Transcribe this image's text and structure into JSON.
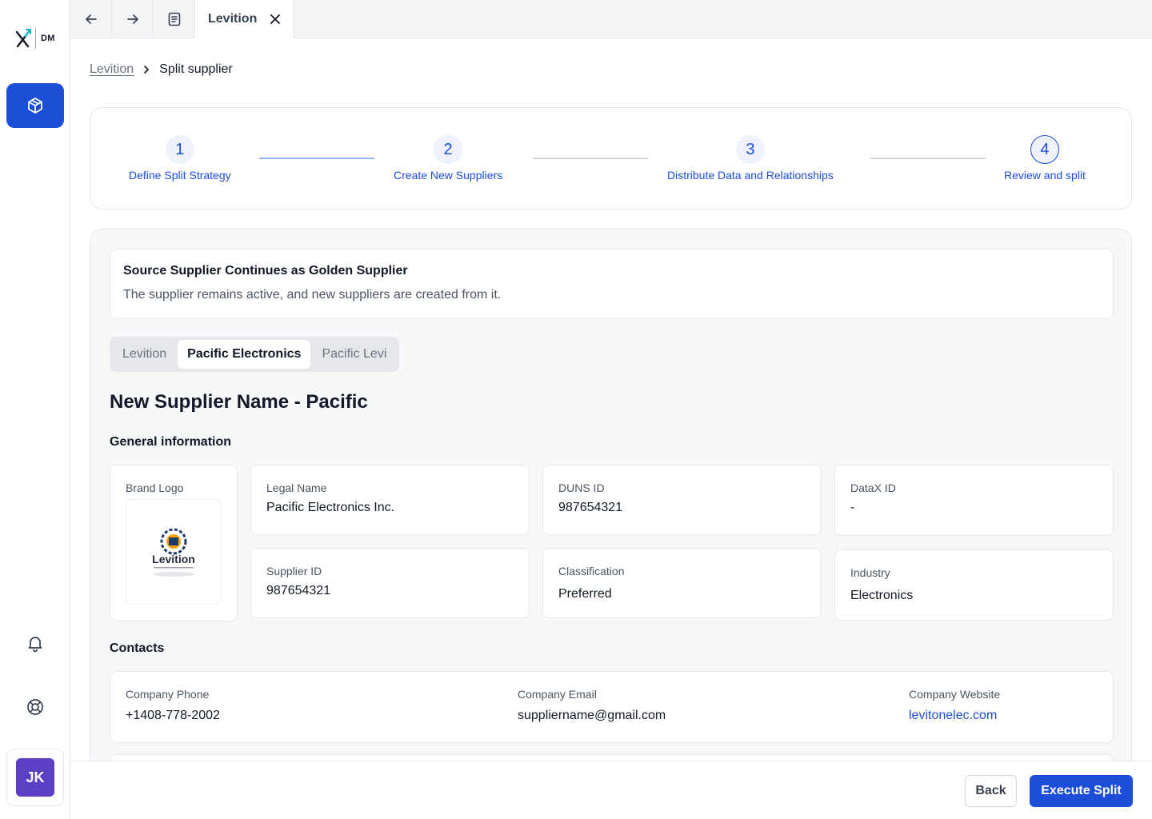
{
  "app": {
    "logo_text": "DM",
    "user_initials": "JK"
  },
  "tabs": [
    {
      "label": "Levition"
    }
  ],
  "breadcrumb": {
    "parent": "Levition",
    "current": "Split supplier"
  },
  "steps": [
    {
      "number": "1",
      "label": "Define Split Strategy"
    },
    {
      "number": "2",
      "label": "Create New Suppliers"
    },
    {
      "number": "3",
      "label": "Distribute Data and Relationships"
    },
    {
      "number": "4",
      "label": "Review and split"
    }
  ],
  "strategy": {
    "title": "Source Supplier Continues as Golden Supplier",
    "description": "The supplier remains active, and new suppliers are created from it."
  },
  "supplier_tabs": [
    {
      "label": "Levition",
      "selected": false
    },
    {
      "label": "Pacific Electronics",
      "selected": true
    },
    {
      "label": "Pacific Levi",
      "selected": false
    }
  ],
  "supplier_title": "New Supplier Name - Pacific",
  "general": {
    "heading": "General information",
    "brand_logo_label": "Brand Logo",
    "brand_logo_text": "Levition",
    "legal_name": {
      "label": "Legal Name",
      "value": "Pacific Electronics Inc."
    },
    "duns_id": {
      "label": "DUNS ID",
      "value": "987654321"
    },
    "datax_id": {
      "label": "DataX ID",
      "value": "-"
    },
    "supplier_id": {
      "label": "Supplier ID",
      "value": "987654321"
    },
    "classification": {
      "label": "Classification",
      "value": "Preferred"
    },
    "industry": {
      "label": "Industry",
      "value": "Electronics"
    }
  },
  "contacts": {
    "heading": "Contacts",
    "phone": {
      "label": "Company Phone",
      "value": "+1408-778-2002"
    },
    "email": {
      "label": "Company Email",
      "value": "suppliername@gmail.com"
    },
    "website": {
      "label": "Company Website",
      "value": "levitonelec.com"
    }
  },
  "footer": {
    "back_label": "Back",
    "execute_label": "Execute Split"
  },
  "colors": {
    "primary": "#1d4ed8",
    "avatar": "#5b3fc4"
  }
}
